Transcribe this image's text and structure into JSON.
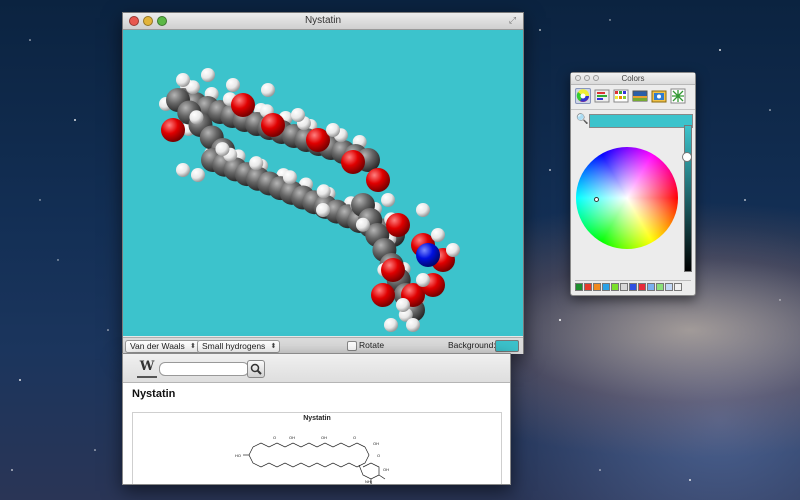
{
  "window": {
    "title": "Nystatin"
  },
  "molecule_view": {
    "background_color": "#3cc3cc",
    "atom_colors": {
      "carbon": "#5a5a5a",
      "oxygen": "#e00000",
      "hydrogen": "#f2f2f2",
      "nitrogen": "#0010e0"
    }
  },
  "controls": {
    "style_popup": "Van der Waals",
    "hydrogens_popup": "Small hydrogens",
    "rotate_label": "Rotate",
    "rotate_checked": false,
    "background_label": "Background:"
  },
  "browser": {
    "search_placeholder": "",
    "page_title": "Nystatin",
    "infobox_caption": "Nystatin"
  },
  "colors_panel": {
    "title": "Colors",
    "current_color": "#3cc3cc",
    "tab_icons": [
      "color-wheel-icon",
      "color-sliders-icon",
      "color-palettes-icon",
      "image-palettes-icon",
      "crayons-icon"
    ],
    "swatch_colors": [
      "#1f8f2e",
      "#e83a2a",
      "#f08a1f",
      "#2aa2e8",
      "#7ae02a",
      "#d8d8d8",
      "#2f4fe0",
      "#e82a3a",
      "#7ab0f0",
      "#8be07a",
      "#c3d8f5",
      "#f0f0f0"
    ]
  }
}
